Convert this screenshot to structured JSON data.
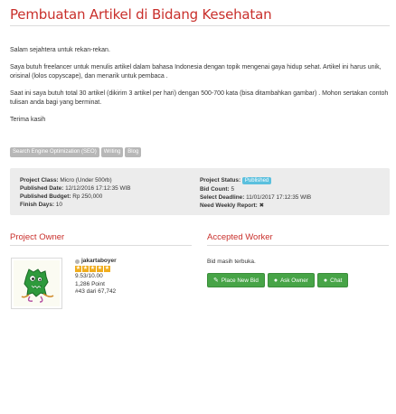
{
  "project": {
    "title": "Pembuatan Artikel di Bidang Kesehatan",
    "description": [
      "Salam sejahtera untuk rekan-rekan.",
      "Saya butuh freelancer untuk menulis artikel dalam bahasa Indonesia dengan topik mengenai gaya hidup sehat. Artikel ini harus unik, orisinal (lolos copyscape),  dan menarik untuk pembaca .",
      "Saat ini saya butuh total 30 artikel (dikirim 3 artikel per hari) dengan 500-700 kata (bisa ditambahkan gambar) . Mohon sertakan contoh tulisan anda bagi yang berminat.",
      "Terima kasih"
    ],
    "tags": [
      "Search Engine Optimization (SEO)",
      "Writing",
      "Blog"
    ]
  },
  "info": {
    "left": [
      {
        "label": "Project Class:",
        "value": "Micro (Under 500rb)"
      },
      {
        "label": "Published Date:",
        "value": "12/12/2016 17:12:35 WIB"
      },
      {
        "label": "Published Budget:",
        "value": "Rp 250,000"
      },
      {
        "label": "Finish Days:",
        "value": "10"
      }
    ],
    "right": {
      "status_label": "Project Status:",
      "status_value": "Published",
      "bid_count_label": "Bid Count:",
      "bid_count_value": "5",
      "deadline_label": "Select Deadline:",
      "deadline_value": "11/01/2017 17:12:35 WIB",
      "weekly_label": "Need Weekly Report:",
      "weekly_value": "✖"
    }
  },
  "owner": {
    "section_title": "Project Owner",
    "username": "jakartaboyer",
    "rating_stars": 5,
    "score": "9.53/10.00",
    "points": "1,286 Point",
    "rank": "#43 dari 67,742"
  },
  "worker": {
    "section_title": "Accepted Worker",
    "bid_status": "Bid masih terbuka.",
    "buttons": [
      {
        "label": "Place New Bid",
        "icon": "pencil-icon"
      },
      {
        "label": "Ask Owner",
        "icon": "chat-icon"
      },
      {
        "label": "Chat",
        "icon": "chats-icon"
      }
    ]
  },
  "colors": {
    "accent": "#c9302c",
    "success": "#47a447",
    "info": "#5bc0de",
    "tag": "#b7b7b7"
  }
}
